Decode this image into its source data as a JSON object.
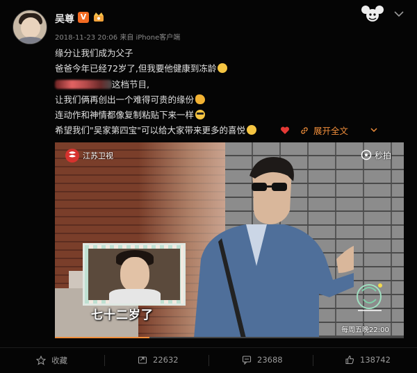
{
  "post": {
    "username": "吴尊",
    "badge_v": "V",
    "timestamp": "2018-11-23 20:06",
    "source": "来自 iPhone客户端",
    "lines": [
      "缘分让我们成为父子",
      "爸爸今年已经72岁了,但我要他健康到冻龄",
      "这档节目,",
      "让我们俩再创出一个难得可贵的缘份",
      "连动作和神情都像复制粘贴下来一样",
      "希望我们\"吴家第四宝\"可以给大家带来更多的喜悦"
    ],
    "expand_label": "展开全文"
  },
  "video": {
    "channel_logo_text": "江苏卫视",
    "watermark_text": "秒拍",
    "subtitle": "七十二岁了",
    "schedule_text": "每周五晚22:00",
    "progress_fraction": 0.27
  },
  "actions": {
    "favorite_label": "收藏",
    "repost_count": "22632",
    "comment_count": "23688",
    "like_count": "138742"
  },
  "colors": {
    "accent": "#f08e3b",
    "badge": "#f36b22",
    "background": "#050505"
  }
}
